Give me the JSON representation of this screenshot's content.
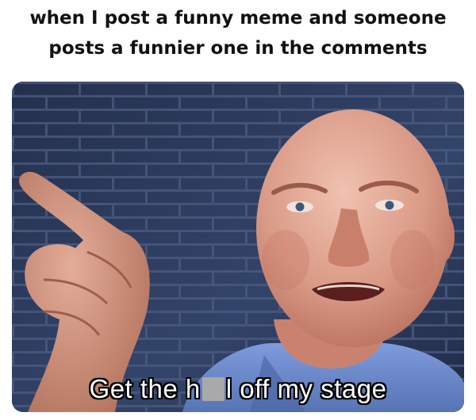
{
  "caption": {
    "line1": "when I post a funny meme and someone",
    "line2": "posts a funnier one in the comments"
  },
  "subtitle": {
    "before": "Get the h",
    "after": "l off my stage"
  },
  "colors": {
    "caption_text": "#111111",
    "brick_wall": "#2e3c5e",
    "mortar": "#5a6a8c",
    "shirt": "#6f8fcf",
    "skin": "#d99a86",
    "subtitle_text": "#ffffff",
    "censor_block": "#a9a9a9"
  }
}
